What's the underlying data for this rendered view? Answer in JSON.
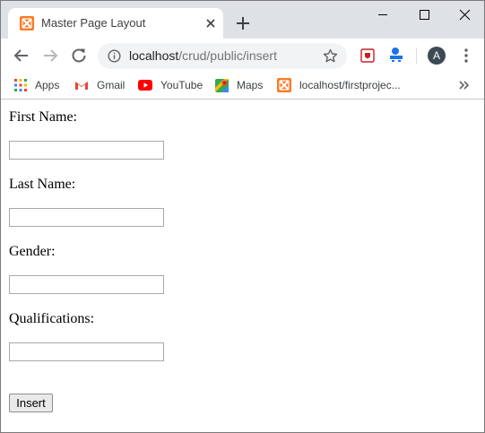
{
  "browser": {
    "tab_title": "Master Page Layout",
    "url_host": "localhost",
    "url_path": "/crud/public/insert",
    "avatar_letter": "A"
  },
  "bookmarks": [
    {
      "label": "Apps",
      "icon": "apps-grid-icon"
    },
    {
      "label": "Gmail",
      "icon": "gmail-icon"
    },
    {
      "label": "YouTube",
      "icon": "youtube-icon"
    },
    {
      "label": "Maps",
      "icon": "maps-icon"
    },
    {
      "label": "localhost/firstprojec...",
      "icon": "xampp-icon"
    }
  ],
  "form": {
    "first_name_label": "First Name:",
    "first_name_value": "",
    "last_name_label": "Last Name:",
    "last_name_value": "",
    "gender_label": "Gender:",
    "gender_value": "",
    "qualifications_label": "Qualifications:",
    "qualifications_value": "",
    "submit_label": "Insert"
  },
  "colors": {
    "tab_strip": "#dee1e6",
    "xampp_orange": "#fb7a24",
    "youtube_red": "#ff0000"
  }
}
